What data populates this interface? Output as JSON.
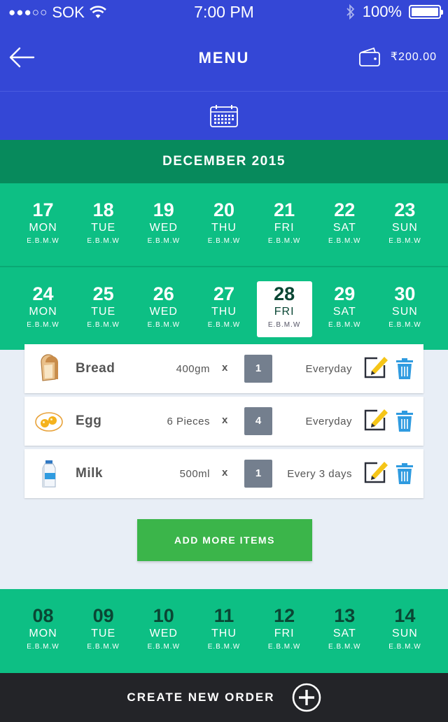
{
  "status_bar": {
    "signal_dots": "●●●○○",
    "carrier": "SOK",
    "time": "7:00 PM",
    "battery": "100%",
    "battery_level": 1.0
  },
  "header": {
    "title": "MENU",
    "wallet_balance": "₹200.00"
  },
  "calendar": {
    "month": "DECEMBER 2015",
    "weeks": [
      [
        {
          "num": "17",
          "name": "MON",
          "sub": "E.B.M.W"
        },
        {
          "num": "18",
          "name": "TUE",
          "sub": "E.B.M.W"
        },
        {
          "num": "19",
          "name": "WED",
          "sub": "E.B.M.W"
        },
        {
          "num": "20",
          "name": "THU",
          "sub": "E.B.M.W"
        },
        {
          "num": "21",
          "name": "FRI",
          "sub": "E.B.M.W"
        },
        {
          "num": "22",
          "name": "SAT",
          "sub": "E.B.M.W"
        },
        {
          "num": "23",
          "name": "SUN",
          "sub": "E.B.M.W"
        }
      ],
      [
        {
          "num": "24",
          "name": "MON",
          "sub": "E.B.M.W"
        },
        {
          "num": "25",
          "name": "TUE",
          "sub": "E.B.M.W"
        },
        {
          "num": "26",
          "name": "WED",
          "sub": "E.B.M.W"
        },
        {
          "num": "27",
          "name": "THU",
          "sub": "E.B.M.W"
        },
        {
          "num": "28",
          "name": "FRI",
          "sub": "E.B.M.W"
        },
        {
          "num": "29",
          "name": "SAT",
          "sub": "E.B.M.W"
        },
        {
          "num": "30",
          "name": "SUN",
          "sub": "E.B.M.W"
        }
      ],
      [
        {
          "num": "08",
          "name": "MON",
          "sub": "E.B.M.W"
        },
        {
          "num": "09",
          "name": "TUE",
          "sub": "E.B.M.W"
        },
        {
          "num": "10",
          "name": "WED",
          "sub": "E.B.M.W"
        },
        {
          "num": "11",
          "name": "THU",
          "sub": "E.B.M.W"
        },
        {
          "num": "12",
          "name": "FRI",
          "sub": "E.B.M.W"
        },
        {
          "num": "13",
          "name": "SAT",
          "sub": "E.B.M.W"
        },
        {
          "num": "14",
          "name": "SUN",
          "sub": "E.B.M.W"
        }
      ]
    ],
    "selected": "28"
  },
  "items": [
    {
      "icon": "bread-icon",
      "name": "Bread",
      "qty": "400gm",
      "x": "x",
      "count": "1",
      "freq": "Everyday"
    },
    {
      "icon": "egg-icon",
      "name": "Egg",
      "qty": "6 Pieces",
      "x": "x",
      "count": "4",
      "freq": "Everyday"
    },
    {
      "icon": "milk-icon",
      "name": "Milk",
      "qty": "500ml",
      "x": "x",
      "count": "1",
      "freq": "Every 3 days"
    }
  ],
  "add_button": "ADD MORE ITEMS",
  "footer": {
    "label": "CREATE NEW ORDER"
  },
  "colors": {
    "header_blue": "#3447d6",
    "month_green": "#078a5c",
    "calendar_green": "#0dbf84",
    "add_green": "#3bb54a",
    "footer_dark": "#232428",
    "edit_yellow": "#f5c518",
    "delete_blue": "#2f9be0"
  }
}
